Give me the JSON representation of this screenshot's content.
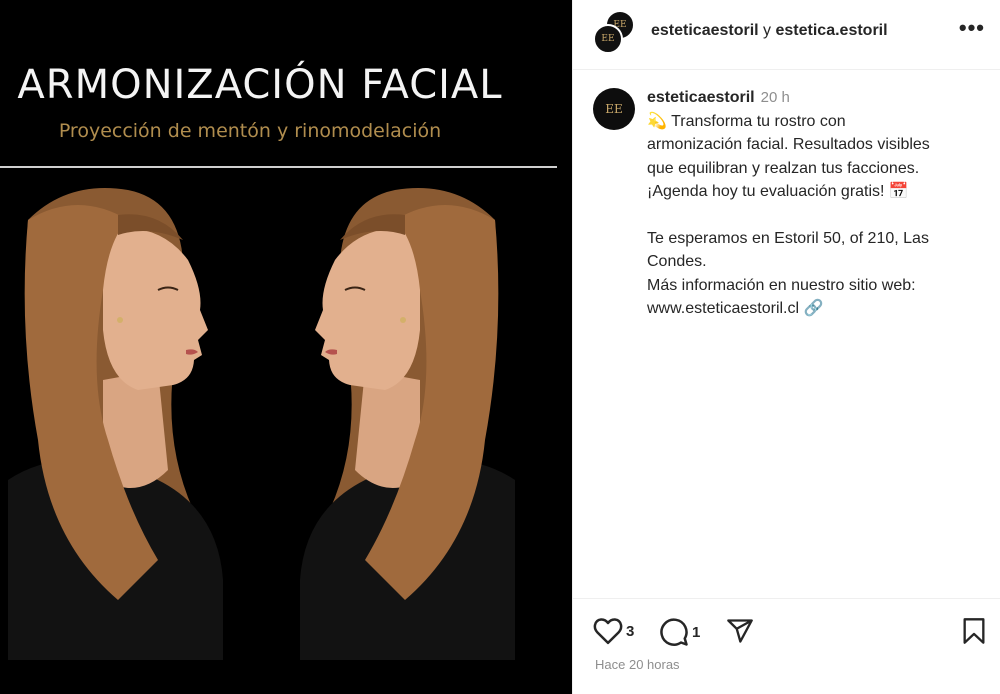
{
  "media": {
    "title": "ARMONIZACIÓN FACIAL",
    "subtitle": "Proyección de mentón y rinomodelación"
  },
  "header": {
    "username_1": "esteticaestoril",
    "connector": " y ",
    "username_2": "estetica.estoril",
    "avatar_text": "EE",
    "more_label": "•••"
  },
  "caption": {
    "avatar_text": "EE",
    "username": "esteticaestoril",
    "time": "20 h",
    "lines_1": [
      "💫 Transforma tu rostro con",
      "armonización facial. Resultados visibles",
      "que equilibran y realzan tus facciones.",
      "¡Agenda hoy tu evaluación gratis! 📅"
    ],
    "lines_2": [
      "Te esperamos en Estoril 50, of 210, Las",
      "Condes.",
      "Más información en nuestro sitio web:",
      "www.esteticaestoril.cl 🔗"
    ]
  },
  "actions": {
    "like_icon": "heart-icon",
    "like_count": "3",
    "comment_icon": "comment-icon",
    "comment_count": "1",
    "share_icon": "send-icon",
    "save_icon": "bookmark-icon",
    "posted": "Hace 20 horas"
  },
  "colors": {
    "gold": "#b08d4e",
    "text": "#262626",
    "muted": "#8e8e8e"
  }
}
